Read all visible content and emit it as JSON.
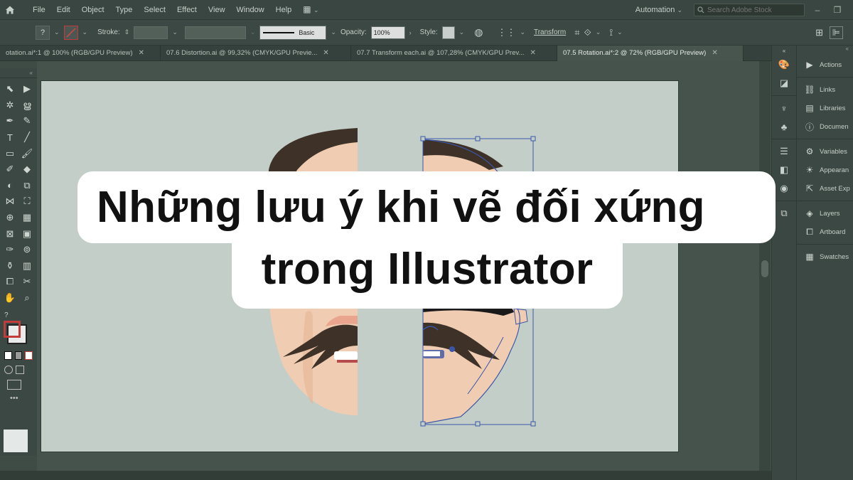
{
  "menubar": {
    "items": [
      "File",
      "Edit",
      "Object",
      "Type",
      "Select",
      "Effect",
      "View",
      "Window",
      "Help"
    ],
    "workspace": "Automation",
    "search_placeholder": "Search Adobe Stock"
  },
  "controlbar": {
    "stroke_label": "Stroke:",
    "brush_label": "Basic",
    "opacity_label": "Opacity:",
    "opacity_value": "100%",
    "style_label": "Style:",
    "transform_label": "Transform"
  },
  "tabs": [
    {
      "label": "otation.ai*:1 @ 100% (RGB/GPU Preview)"
    },
    {
      "label": "07.6 Distortion.ai @ 99,32% (CMYK/GPU Previe..."
    },
    {
      "label": "07.7 Transform each.ai @ 107,28% (CMYK/GPU Prev..."
    },
    {
      "label": "07.5 Rotation.ai*:2 @ 72% (RGB/GPU Preview)"
    }
  ],
  "panels": {
    "items": [
      "Actions",
      "Links",
      "Libraries",
      "Documen",
      "Variables",
      "Appearan",
      "Asset Exp",
      "Layers",
      "Artboard",
      "Swatches"
    ]
  },
  "banner": {
    "line1": "Những lưu ý khi vẽ đối xứng",
    "line2": "trong Illustrator"
  },
  "colors": {
    "hair": "#3e3128",
    "skin": "#f0cdb2",
    "skin_shade": "#e6b494",
    "selection": "#3b56a8",
    "accent": "#b84c4c"
  }
}
